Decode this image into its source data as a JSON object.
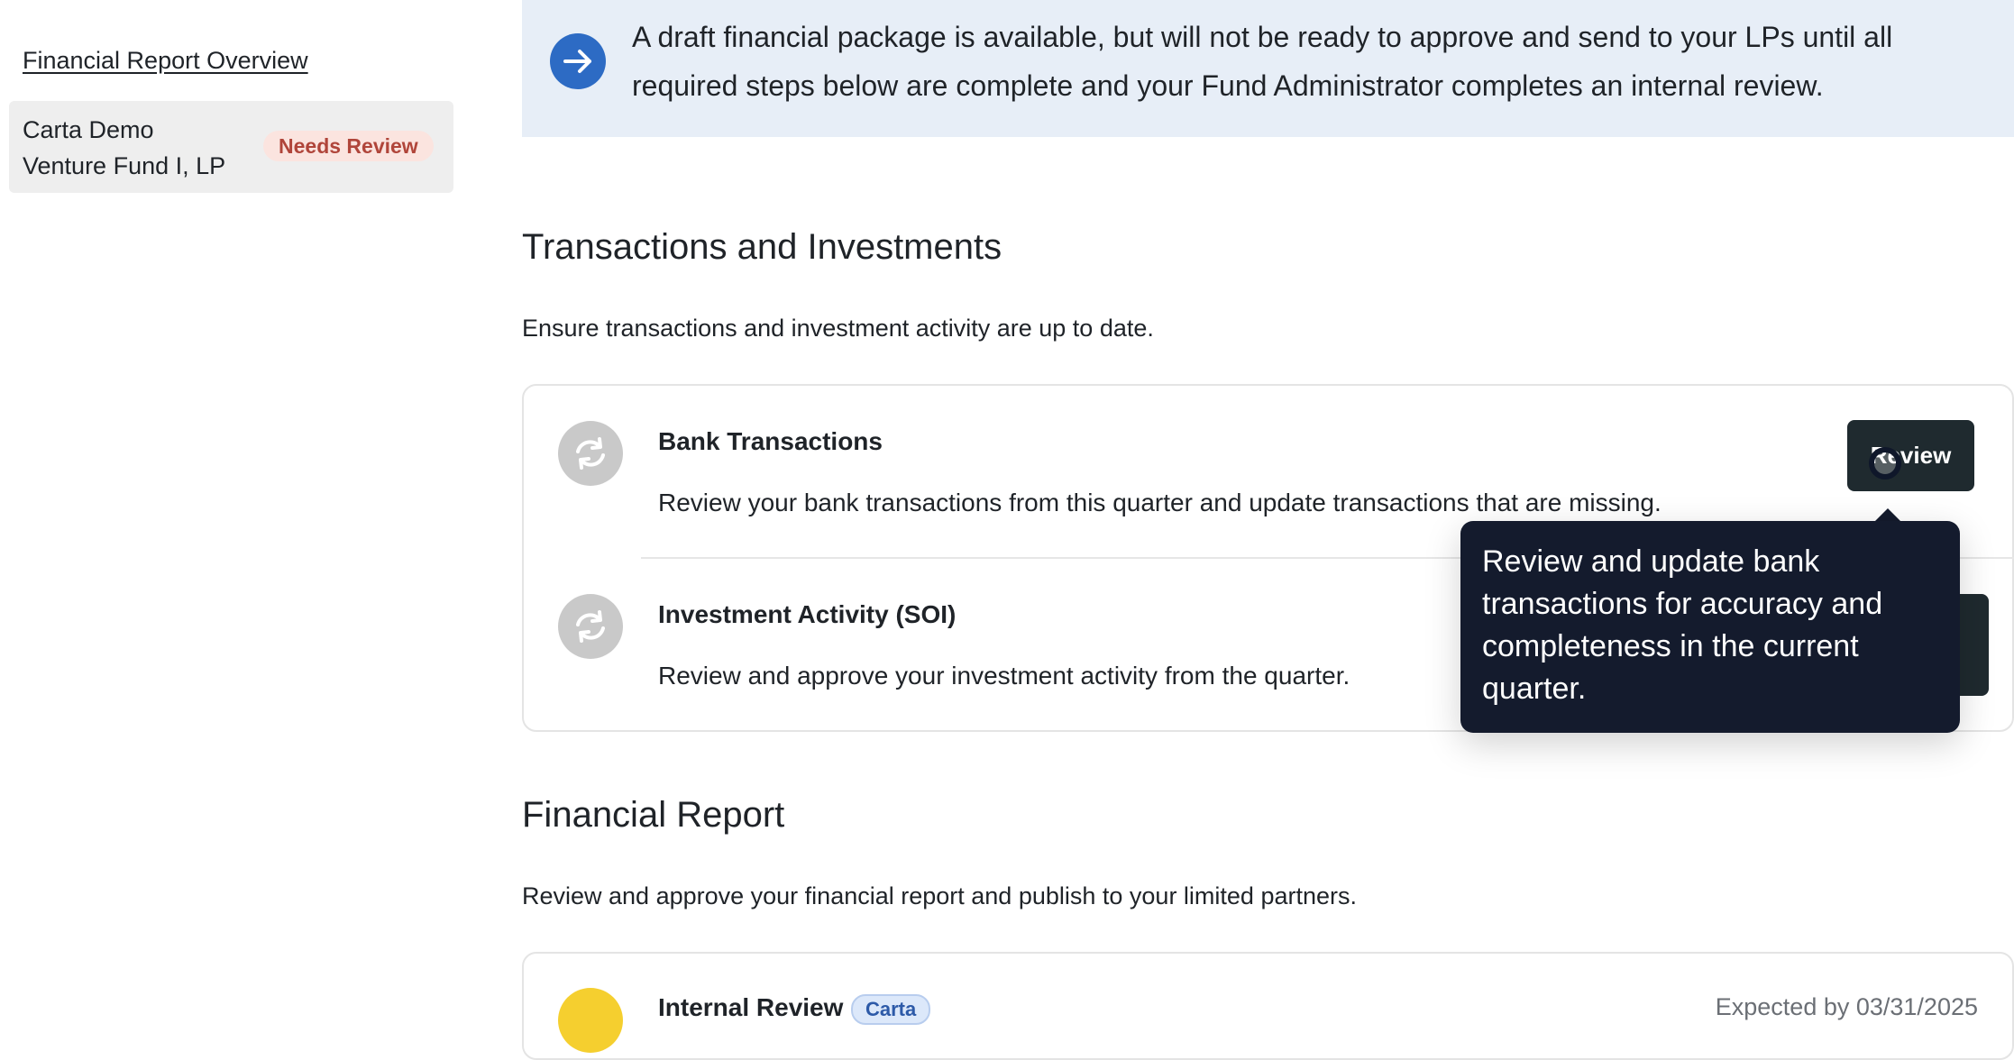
{
  "sidebar": {
    "overview_link": "Financial Report Overview",
    "funds": [
      {
        "name_line1": "Carta Demo",
        "name_line2": "Venture Fund I, LP",
        "status": "Needs Review"
      }
    ]
  },
  "banner": {
    "icon": "arrow-right-icon",
    "text": "A draft financial package is available, but will not be ready to approve and send to your LPs until all required steps below are complete and your Fund Administrator completes an internal review."
  },
  "transactions_section": {
    "title": "Transactions and Investments",
    "subtitle": "Ensure transactions and investment activity are up to date.",
    "rows": [
      {
        "title": "Bank Transactions",
        "description": "Review your bank transactions from this quarter and update transactions that are missing.",
        "button_label": "Review",
        "icon": "sync-icon"
      },
      {
        "title": "Investment Activity (SOI)",
        "description": "Review and approve your investment activity from the quarter.",
        "icon": "sync-icon"
      }
    ]
  },
  "tooltip": {
    "text": "Review and update bank transactions for accuracy and completeness in the current quarter."
  },
  "financial_report_section": {
    "title": "Financial Report",
    "subtitle": "Review and approve your financial report and publish to your limited partners.",
    "rows": [
      {
        "title": "Internal Review",
        "badge": "Carta",
        "expected": "Expected by 03/31/2025"
      }
    ]
  },
  "colors": {
    "banner_bg": "#e7eef7",
    "accent_blue": "#2d6bc4",
    "dark_button": "#1f2a2f",
    "tooltip_bg": "#141b2d",
    "needs_review_text": "#b0453a",
    "needs_review_bg": "#fbe4df"
  }
}
